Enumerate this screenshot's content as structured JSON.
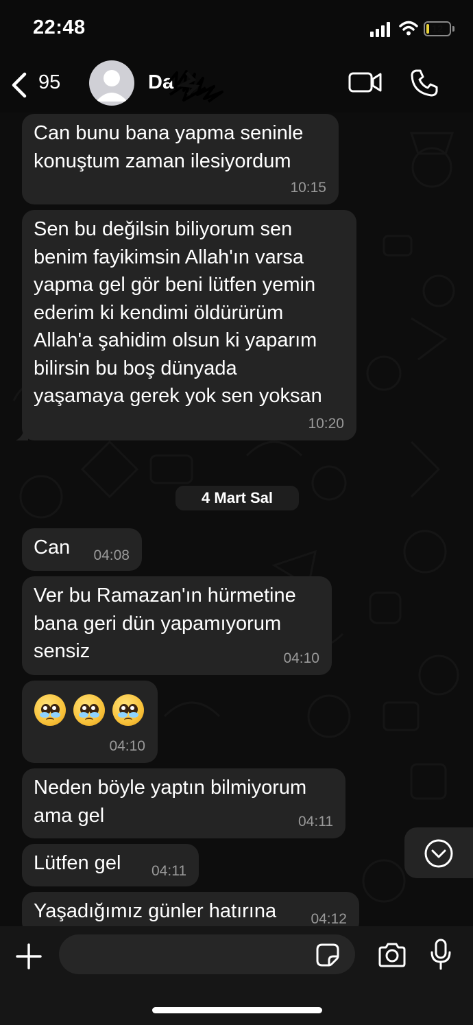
{
  "status_bar": {
    "time": "22:48",
    "battery": "12",
    "battery_level": 0.12
  },
  "header": {
    "back_count": "95",
    "contact_name": "Da"
  },
  "messages": [
    {
      "text": "Can bunu bana yapma seninle\nkonuştum zaman ilesiyordum",
      "time": "10:15"
    },
    {
      "text": "Sen bu değilsin biliyorum sen\nbenim fayikimsin Allah'ın varsa\nyapma gel gör beni lütfen yemin\nederim ki kendimi öldürürüm\nAllah'a şahidim olsun ki yaparım\nbilirsin bu boş dünyada\nyaşamaya gerek yok sen yoksan",
      "time": "10:20"
    },
    {
      "text": "Can",
      "time": "04:08"
    },
    {
      "text": "Ver bu Ramazan'ın hürmetine\nbana geri dün yapamıyorum\nsensiz",
      "time": "04:10"
    },
    {
      "emoji_count": 3,
      "emoji_name": "pleading-face",
      "time": "04:10"
    },
    {
      "text": "Neden böyle yaptın bilmiyorum\nama gel",
      "time": "04:11"
    },
    {
      "text": "Lütfen gel",
      "time": "04:11"
    },
    {
      "text": "Yaşadığımız günler hatırına",
      "time": "04:12"
    }
  ],
  "date_separator": "4 Mart Sal",
  "composer": {
    "placeholder": ""
  }
}
